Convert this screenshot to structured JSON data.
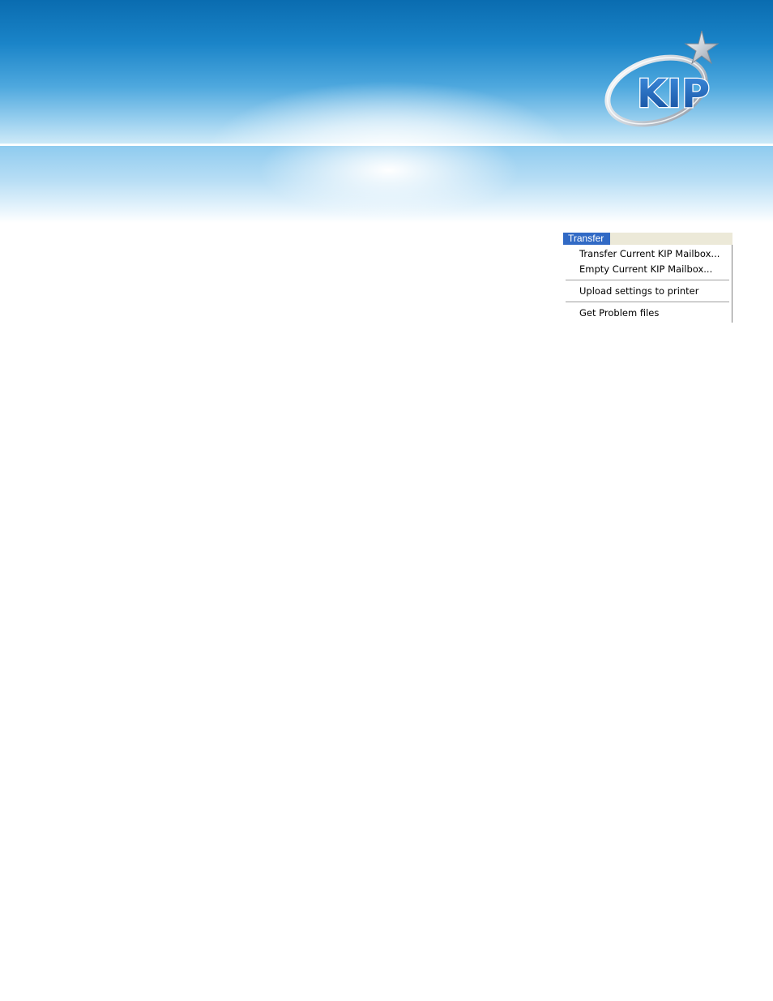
{
  "logo": {
    "brand": "KIP",
    "icon": "kip-star-logo-icon",
    "colors": {
      "text": "#1f63b4",
      "ring": "#c8ced6",
      "star": "#b9c0c8"
    }
  },
  "menu": {
    "title": "Transfer",
    "items": [
      {
        "label": "Transfer Current KIP Mailbox..."
      },
      {
        "label": "Empty Current KIP Mailbox..."
      },
      {
        "label": "Upload settings to printer"
      },
      {
        "label": "Get Problem files"
      }
    ],
    "colors": {
      "highlight": "#316ac5",
      "bar": "#ece9d8"
    }
  }
}
